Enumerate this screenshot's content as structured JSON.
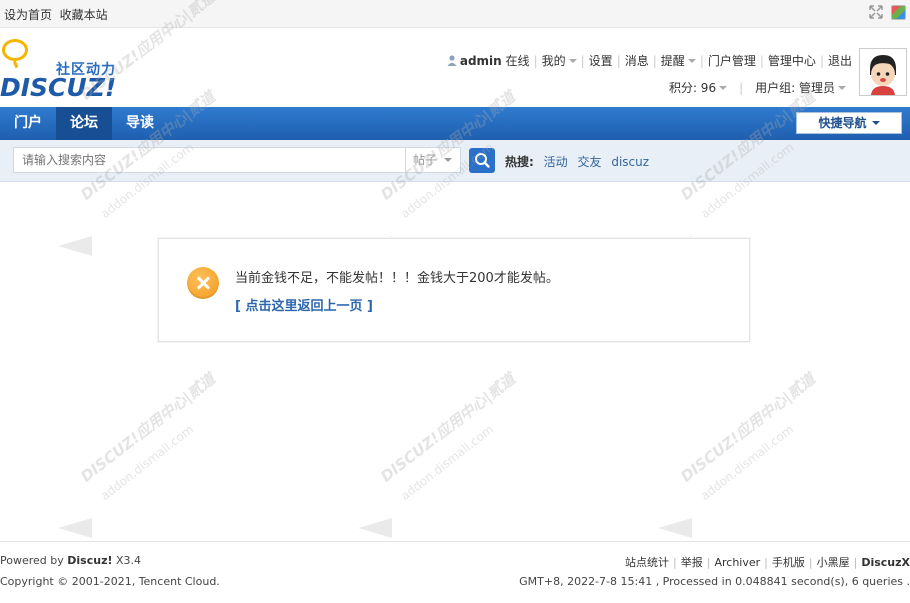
{
  "topbar": {
    "set_homepage": "设为首页",
    "bookmark": "收藏本站"
  },
  "logo": {
    "tagline": "社区动力",
    "brand": "DISCUZ!"
  },
  "user_nav": {
    "username": "admin",
    "status": "在线",
    "my": "我的",
    "settings": "设置",
    "messages": "消息",
    "reminders": "提醒",
    "portal_admin": "门户管理",
    "admin_center": "管理中心",
    "logout": "退出"
  },
  "user_stat": {
    "credits": "积分: 96",
    "usergroup": "用户组: 管理员"
  },
  "nav": {
    "tabs": [
      {
        "label": "门户"
      },
      {
        "label": "论坛"
      },
      {
        "label": "导读"
      }
    ],
    "active": "论坛",
    "quick_nav": "快捷导航"
  },
  "search": {
    "placeholder": "请输入搜索内容",
    "type": "帖子",
    "hot_label": "热搜:",
    "hot_terms": [
      "活动",
      "交友",
      "discuz"
    ]
  },
  "message": {
    "text": "当前金钱不足，不能发帖！！！金钱大于200才能发帖。",
    "back_link": "[ 点击这里返回上一页 ]",
    "accent": "#f4a12a"
  },
  "watermark": {
    "line1": "DISCUZ!应用中心|贰道",
    "line2": "addon.dismall.com"
  },
  "footer": {
    "powered_prefix": "Powered by",
    "powered_brand": "Discuz!",
    "version": "X3.4",
    "copyright": "Copyright © 2001-2021, Tencent Cloud.",
    "links": [
      "站点统计",
      "举报",
      "Archiver",
      "手机版",
      "小黑屋"
    ],
    "brand_link": "DiscuzX",
    "debug": "GMT+8, 2022-7-8 15:41 , Processed in 0.048841 second(s), 6 queries ."
  },
  "colors": {
    "nav_blue": "#2f7bd0",
    "link_blue": "#2b66b0"
  }
}
